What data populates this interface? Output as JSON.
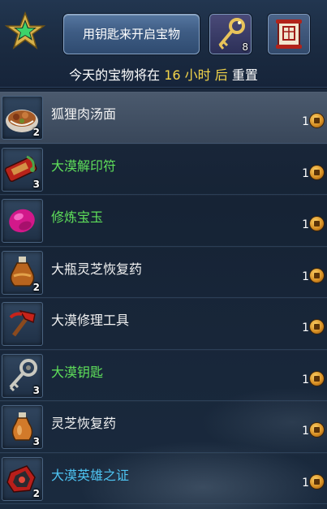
{
  "header": {
    "open_button_label": "用钥匙来开启宝物",
    "key_count": "8",
    "reset_prefix": "今天的宝物将在",
    "reset_hours": "16",
    "reset_unit": "小时",
    "reset_after": "后",
    "reset_suffix": "重置"
  },
  "items": [
    {
      "name": "狐狸肉汤面",
      "qty": "2",
      "price": "1",
      "color": "#f2f2f2",
      "icon": "noodle-soup-icon"
    },
    {
      "name": "大漠解印符",
      "qty": "3",
      "price": "1",
      "color": "#5fe05a",
      "icon": "talisman-icon"
    },
    {
      "name": "修炼宝玉",
      "qty": "",
      "price": "1",
      "color": "#5fe05a",
      "icon": "jade-gem-icon"
    },
    {
      "name": "大瓶灵芝恢复药",
      "qty": "2",
      "price": "1",
      "color": "#f2f2f2",
      "icon": "large-potion-icon"
    },
    {
      "name": "大漠修理工具",
      "qty": "",
      "price": "1",
      "color": "#f2f2f2",
      "icon": "repair-hammer-icon"
    },
    {
      "name": "大漠钥匙",
      "qty": "3",
      "price": "1",
      "color": "#5fe05a",
      "icon": "key-icon"
    },
    {
      "name": "灵芝恢复药",
      "qty": "3",
      "price": "1",
      "color": "#f2f2f2",
      "icon": "potion-icon"
    },
    {
      "name": "大漠英雄之证",
      "qty": "2",
      "price": "1",
      "color": "#4ec4f2",
      "icon": "hero-badge-icon"
    }
  ],
  "colors": {
    "highlight": "#f3d54a",
    "rare_green": "#5fe05a",
    "epic_blue": "#4ec4f2"
  }
}
